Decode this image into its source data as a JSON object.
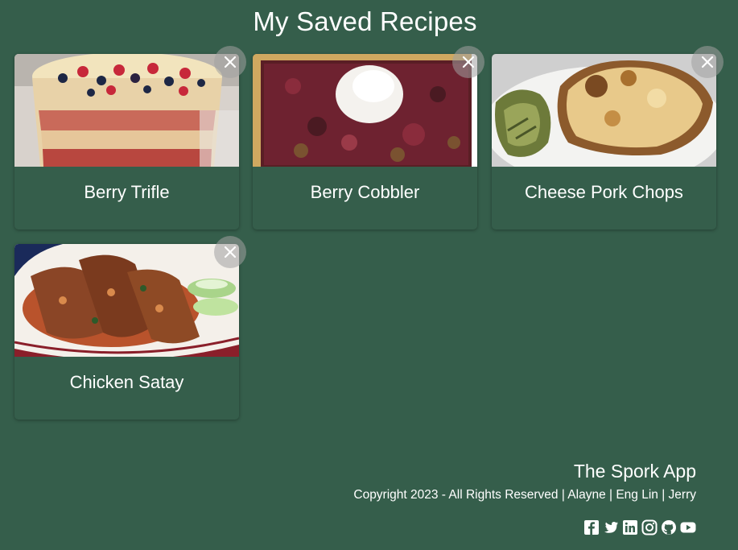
{
  "page": {
    "title": "My Saved Recipes"
  },
  "recipes": [
    {
      "name": "Berry Trifle",
      "image": "berry-trifle-photo"
    },
    {
      "name": "Berry Cobbler",
      "image": "berry-cobbler-photo"
    },
    {
      "name": "Cheese Pork Chops",
      "image": "cheese-pork-chops-photo"
    },
    {
      "name": "Chicken Satay",
      "image": "chicken-satay-photo"
    }
  ],
  "footer": {
    "app_name": "The Spork App",
    "copyright": "Copyright 2023 - All Rights Reserved | Alayne | Eng Lin | Jerry",
    "social": [
      "facebook-icon",
      "twitter-icon",
      "linkedin-icon",
      "instagram-icon",
      "github-icon",
      "youtube-icon"
    ]
  },
  "colors": {
    "background": "#355e4b",
    "text": "#ffffff",
    "close_button": "#a0a0a0"
  }
}
